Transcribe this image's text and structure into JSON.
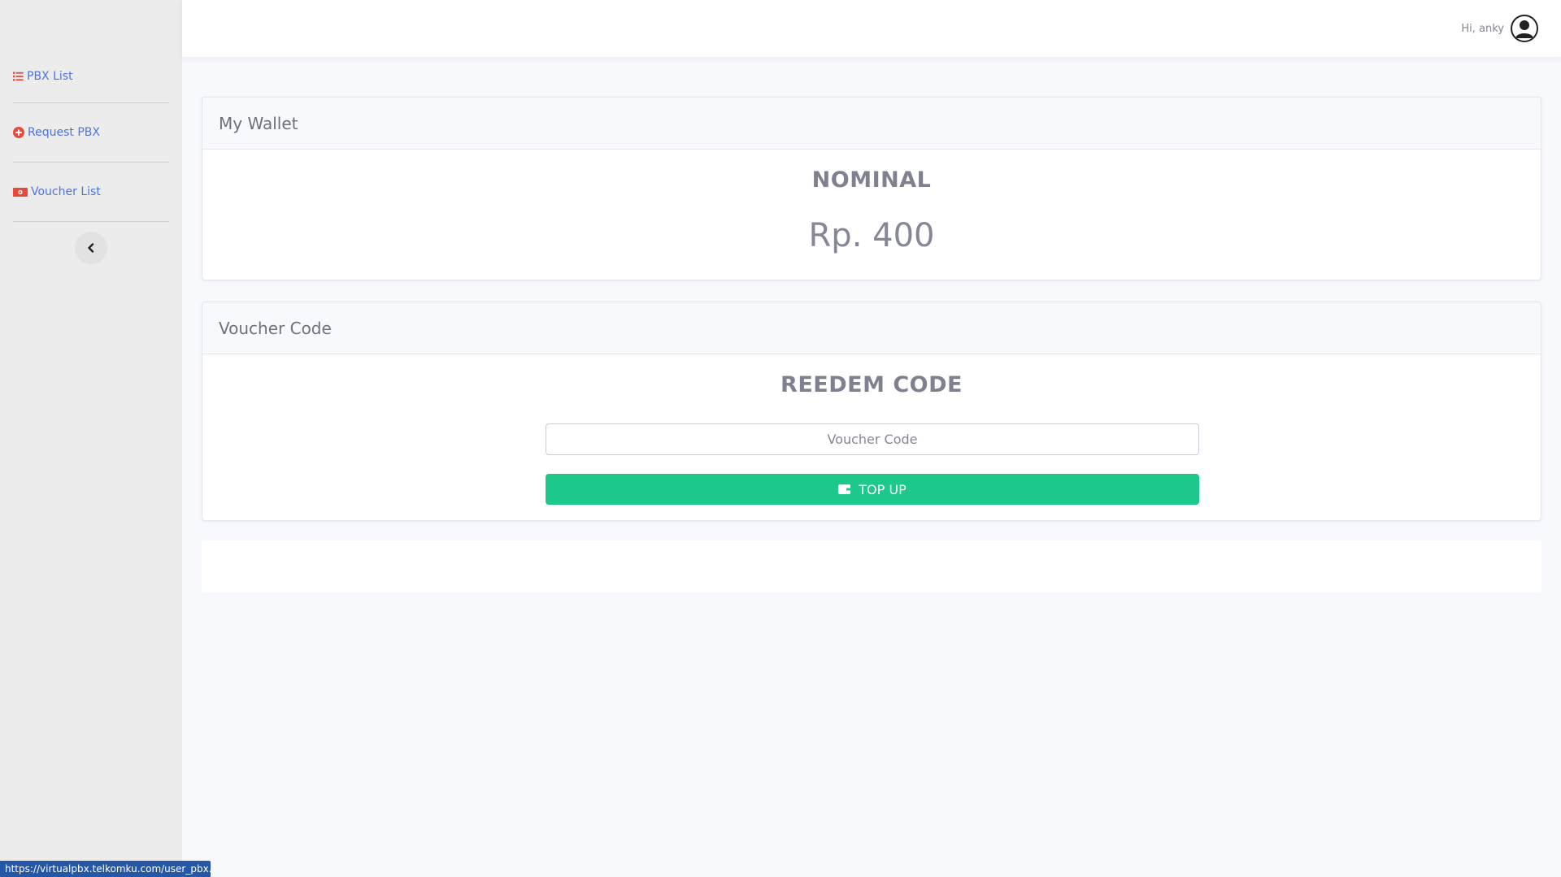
{
  "sidebar": {
    "items": [
      {
        "label": "PBX List",
        "icon": "list-icon"
      },
      {
        "label": "Request PBX",
        "icon": "plus-circle-icon"
      },
      {
        "label": "Voucher List",
        "icon": "ticket-icon"
      }
    ],
    "collapse_icon": "chevron-left-icon"
  },
  "topbar": {
    "greeting": "Hi, anky",
    "avatar_icon": "user-avatar-icon"
  },
  "wallet_card": {
    "header": "My Wallet",
    "title": "NOMINAL",
    "amount": "Rp. 400"
  },
  "voucher_card": {
    "header": "Voucher Code",
    "title": "REEDEM CODE",
    "input_placeholder": "Voucher Code",
    "input_value": "",
    "button_label": "TOP UP",
    "button_icon": "wallet-icon"
  },
  "status_bar": {
    "url": "https://virtualpbx.telkomku.com/user_pbx.html"
  },
  "colors": {
    "accent": "#4e73df",
    "success": "#1cc88a",
    "icon_red": "#e74a3b"
  }
}
